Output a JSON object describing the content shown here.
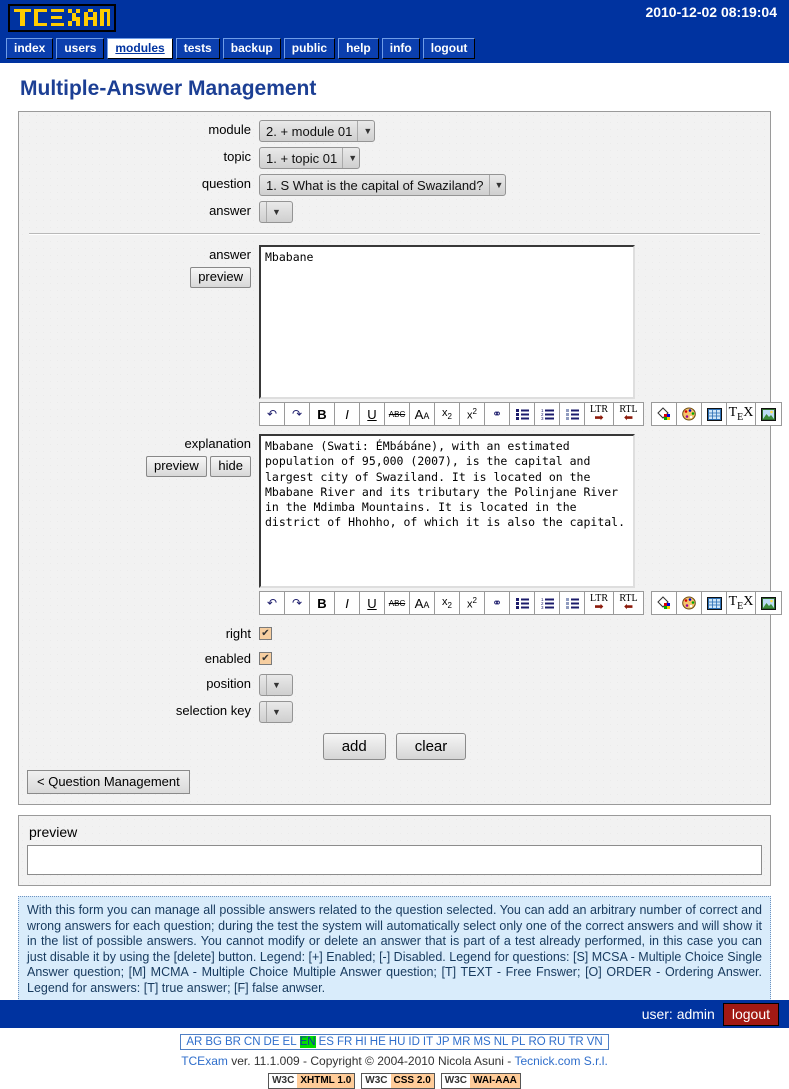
{
  "header": {
    "logo_text": "TCEXAM",
    "datetime": "2010-12-02 08:19:04"
  },
  "nav": {
    "items": [
      {
        "label": "index",
        "active": false
      },
      {
        "label": "users",
        "active": false
      },
      {
        "label": "modules",
        "active": true
      },
      {
        "label": "tests",
        "active": false
      },
      {
        "label": "backup",
        "active": false
      },
      {
        "label": "public",
        "active": false
      },
      {
        "label": "help",
        "active": false
      },
      {
        "label": "info",
        "active": false
      },
      {
        "label": "logout",
        "active": false
      }
    ]
  },
  "page": {
    "title": "Multiple-Answer Management"
  },
  "selectors": {
    "module_label": "module",
    "module_value": "2. + module 01",
    "topic_label": "topic",
    "topic_value": "1. + topic 01",
    "question_label": "question",
    "question_value": "1. S What is the capital of Swaziland?",
    "answer_label": "answer",
    "answer_value": ""
  },
  "answer_field": {
    "label": "answer",
    "preview_label": "preview",
    "value": "Mbabane"
  },
  "explanation_field": {
    "label": "explanation",
    "preview_label": "preview",
    "hide_label": "hide",
    "value": "Mbabane (Swati: ÉMbábáne), with an estimated\npopulation of 95,000 (2007), is the capital and\nlargest city of Swaziland. It is located on the\nMbabane River and its tributary the Polinjane River\nin the Mdimba Mountains. It is located in the\ndistrict of Hhohho, of which it is also the capital."
  },
  "toolbar": {
    "buttons": [
      {
        "name": "undo-icon",
        "glyph": "↶"
      },
      {
        "name": "redo-icon",
        "glyph": "↷"
      },
      {
        "name": "bold-icon",
        "glyph": "B"
      },
      {
        "name": "italic-icon",
        "glyph": "I"
      },
      {
        "name": "underline-icon",
        "glyph": "U"
      },
      {
        "name": "strikethrough-icon",
        "glyph": "ABC"
      },
      {
        "name": "font-size-icon",
        "glyph": "AA"
      },
      {
        "name": "subscript-icon",
        "glyph": "x2"
      },
      {
        "name": "superscript-icon",
        "glyph": "x2"
      },
      {
        "name": "link-icon",
        "glyph": "∞"
      },
      {
        "name": "unordered-list-icon",
        "glyph": "list"
      },
      {
        "name": "ordered-list-icon",
        "glyph": "list"
      },
      {
        "name": "definition-list-icon",
        "glyph": "list"
      },
      {
        "name": "ltr-direction-icon",
        "glyph": "LTR"
      },
      {
        "name": "rtl-direction-icon",
        "glyph": "RTL"
      },
      {
        "name": "background-color-icon",
        "glyph": "fill"
      },
      {
        "name": "text-color-icon",
        "glyph": "palette"
      },
      {
        "name": "table-icon",
        "glyph": "table"
      },
      {
        "name": "tex-formula-icon",
        "glyph": "TeX"
      },
      {
        "name": "insert-image-icon",
        "glyph": "image"
      }
    ]
  },
  "options": {
    "right_label": "right",
    "right_checked": true,
    "enabled_label": "enabled",
    "enabled_checked": true,
    "position_label": "position",
    "position_value": "",
    "selection_key_label": "selection key",
    "selection_key_value": "",
    "checkmark": "✔"
  },
  "actions": {
    "add_label": "add",
    "clear_label": "clear",
    "back_label": "< Question Management"
  },
  "preview": {
    "label": "preview",
    "content": ""
  },
  "help": {
    "text": "With this form you can manage all possible answers related to the question selected. You can add an arbitrary number of correct and wrong answers for each question; during the test the system will automatically select only one of the correct answers and will show it in the list of possible answers. You cannot modify or delete an answer that is part of a test already performed, in this case you can just disable it by using the [delete] button. Legend: [+] Enabled; [-] Disabled. Legend for questions: [S] MCSA - Multiple Choice Single Answer question; [M] MCMA - Multiple Choice Multiple Answer question; [T] TEXT - Free Fnswer; [O] ORDER - Ordering Answer. Legend for answers: [T] true answer; [F] false anwser."
  },
  "footer": {
    "user_label": "user: admin",
    "logout_label": "logout",
    "languages": [
      "AR",
      "BG",
      "BR",
      "CN",
      "DE",
      "EL",
      "EN",
      "ES",
      "FR",
      "HI",
      "HE",
      "HU",
      "ID",
      "IT",
      "JP",
      "MR",
      "MS",
      "NL",
      "PL",
      "RO",
      "RU",
      "TR",
      "VN"
    ],
    "current_language": "EN",
    "copyright_app": "TCExam",
    "copyright_text": " ver. 11.1.009 - Copyright © 2004-2010 Nicola Asuni - ",
    "copyright_link": "Tecnick.com S.r.l.",
    "badges": [
      {
        "left": "W3C",
        "right": "XHTML 1.0"
      },
      {
        "left": "W3C",
        "right": "CSS 2.0"
      },
      {
        "left": "W3C",
        "right": "WAI-AAA"
      }
    ]
  },
  "colors": {
    "brand_blue": "#0033a0",
    "title_blue": "#1c3f94",
    "logout_red": "#a11914",
    "help_bg": "#d9ecfb",
    "lang_active": "#00dd00"
  }
}
